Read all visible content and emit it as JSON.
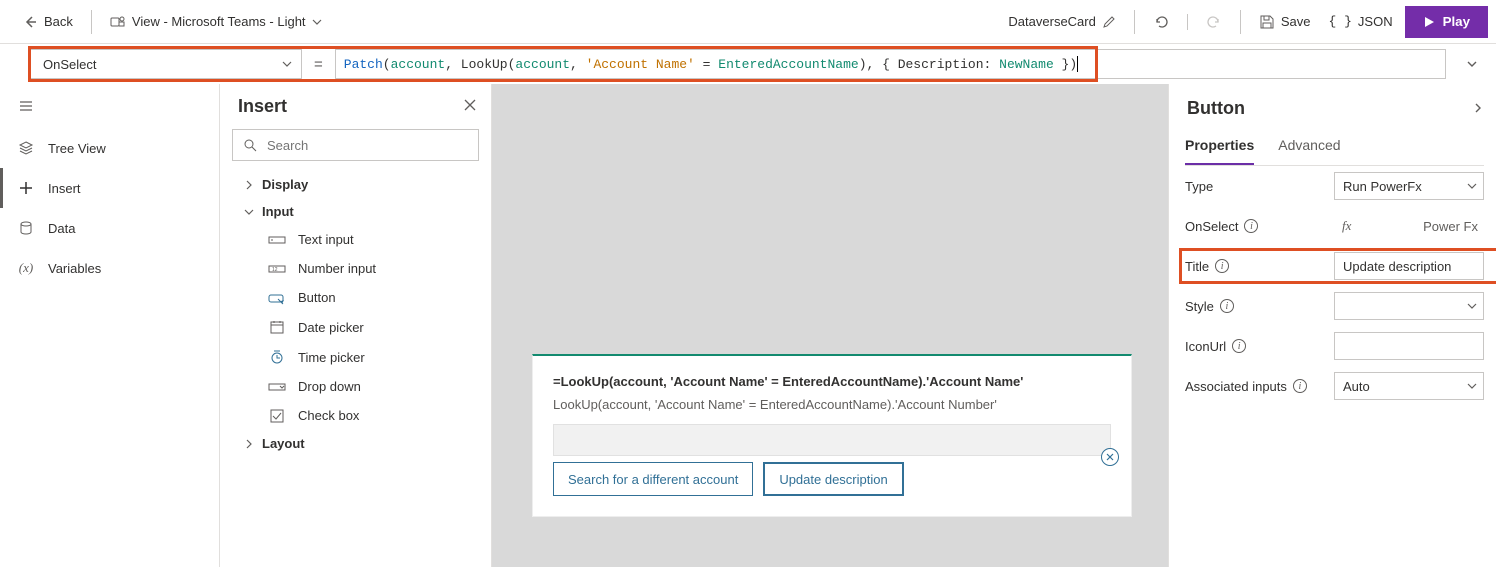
{
  "topbar": {
    "back_label": "Back",
    "view_label": "View - Microsoft Teams - Light",
    "doc_name": "DataverseCard",
    "save_label": "Save",
    "json_label": "JSON",
    "play_label": "Play"
  },
  "formula": {
    "property": "OnSelect",
    "code_parts": {
      "p1": "Patch",
      "p2": "(",
      "p3": "account",
      "p4": ", LookUp(",
      "p5": "account",
      "p6": ", ",
      "p7": "'Account Name'",
      "p8": " = ",
      "p9": "EnteredAccountName",
      "p10": "), { Description: ",
      "p11": "NewName",
      "p12": " })"
    }
  },
  "leftrail": {
    "tree": "Tree View",
    "insert": "Insert",
    "data": "Data",
    "vars": "Variables"
  },
  "insert": {
    "title": "Insert",
    "search_placeholder": "Search",
    "cat_display": "Display",
    "cat_input": "Input",
    "cat_layout": "Layout",
    "items": {
      "text_input": "Text input",
      "number_input": "Number input",
      "button": "Button",
      "date_picker": "Date picker",
      "time_picker": "Time picker",
      "drop_down": "Drop down",
      "check_box": "Check box"
    }
  },
  "card": {
    "line1": "=LookUp(account, 'Account Name' = EnteredAccountName).'Account Name'",
    "line2": "LookUp(account, 'Account Name' = EnteredAccountName).'Account Number'",
    "btn_search": "Search for a different account",
    "btn_update": "Update description"
  },
  "props": {
    "title": "Button",
    "tab_properties": "Properties",
    "tab_advanced": "Advanced",
    "rows": {
      "type_label": "Type",
      "type_value": "Run PowerFx",
      "onselect_label": "OnSelect",
      "onselect_value": "Power Fx",
      "title_label": "Title",
      "title_value": "Update description",
      "style_label": "Style",
      "style_value": "",
      "iconurl_label": "IconUrl",
      "iconurl_value": "",
      "assoc_label": "Associated inputs",
      "assoc_value": "Auto"
    }
  }
}
